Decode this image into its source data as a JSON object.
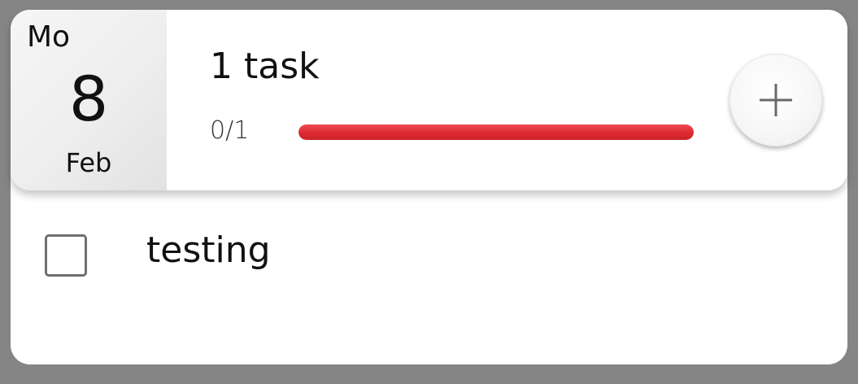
{
  "date": {
    "weekday": "Mo",
    "day": "8",
    "month": "Feb"
  },
  "summary": {
    "task_count_label": "1 task",
    "progress_label": "0/1",
    "progress_fraction": 1.0,
    "progress_color": "#dd2a30"
  },
  "actions": {
    "add_icon": "plus-icon"
  },
  "tasks": [
    {
      "title": "testing",
      "done": false
    }
  ],
  "colors": {
    "background": "#858585",
    "card": "#ffffff",
    "accent_red": "#dd2a30"
  }
}
